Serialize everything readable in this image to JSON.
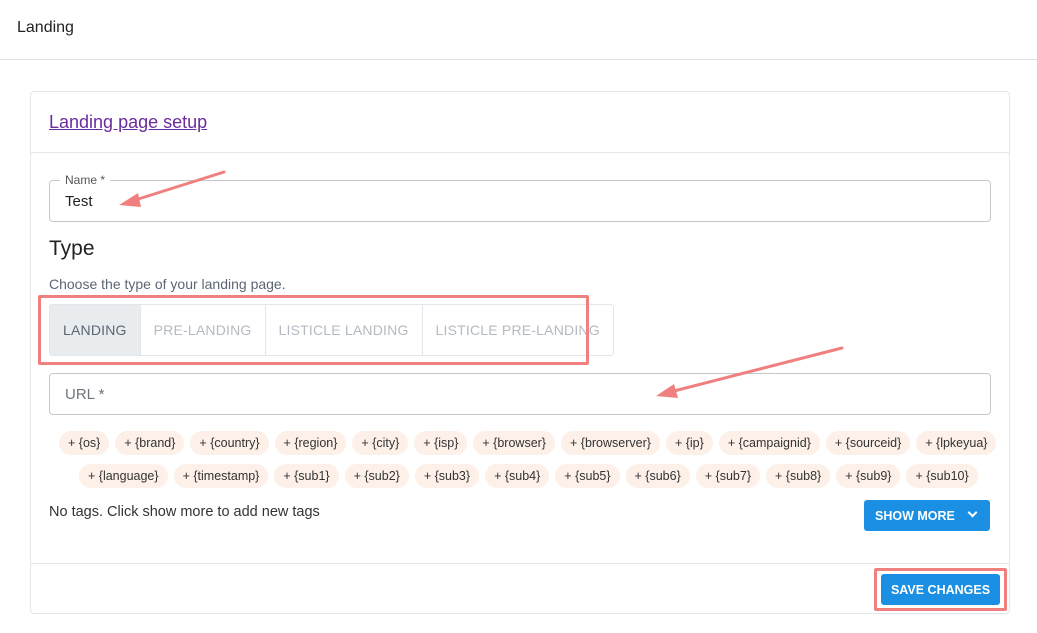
{
  "page": {
    "title": "Landing"
  },
  "card": {
    "header_link": "Landing page setup"
  },
  "name_field": {
    "label": "Name *",
    "value": "Test"
  },
  "type_section": {
    "title": "Type",
    "help": "Choose the type of your landing page.",
    "tabs": [
      {
        "label": "LANDING",
        "active": true
      },
      {
        "label": "PRE-LANDING",
        "active": false
      },
      {
        "label": "LISTICLE LANDING",
        "active": false
      },
      {
        "label": "LISTICLE PRE-LANDING",
        "active": false
      }
    ]
  },
  "url_field": {
    "placeholder": "URL *"
  },
  "tags": {
    "row1": [
      "+ {os}",
      "+ {brand}",
      "+ {country}",
      "+ {region}",
      "+ {city}",
      "+ {isp}",
      "+ {browser}",
      "+ {browserver}",
      "+ {ip}",
      "+ {campaignid}",
      "+ {sourceid}",
      "+ {lpkeyua}"
    ],
    "row2": [
      "+ {language}",
      "+ {timestamp}",
      "+ {sub1}",
      "+ {sub2}",
      "+ {sub3}",
      "+ {sub4}",
      "+ {sub5}",
      "+ {sub6}",
      "+ {sub7}",
      "+ {sub8}",
      "+ {sub9}",
      "+ {sub10}"
    ]
  },
  "no_tags_text": "No tags. Click show more to add new tags",
  "show_more_label": "SHOW MORE",
  "save_label": "SAVE CHANGES",
  "colors": {
    "primary": "#1a8fe3",
    "link": "#6a2b9e",
    "tag_bg": "#fdf0e8",
    "annotation": "#f08080"
  },
  "icons": {
    "show_more": "chevron-down-icon"
  }
}
